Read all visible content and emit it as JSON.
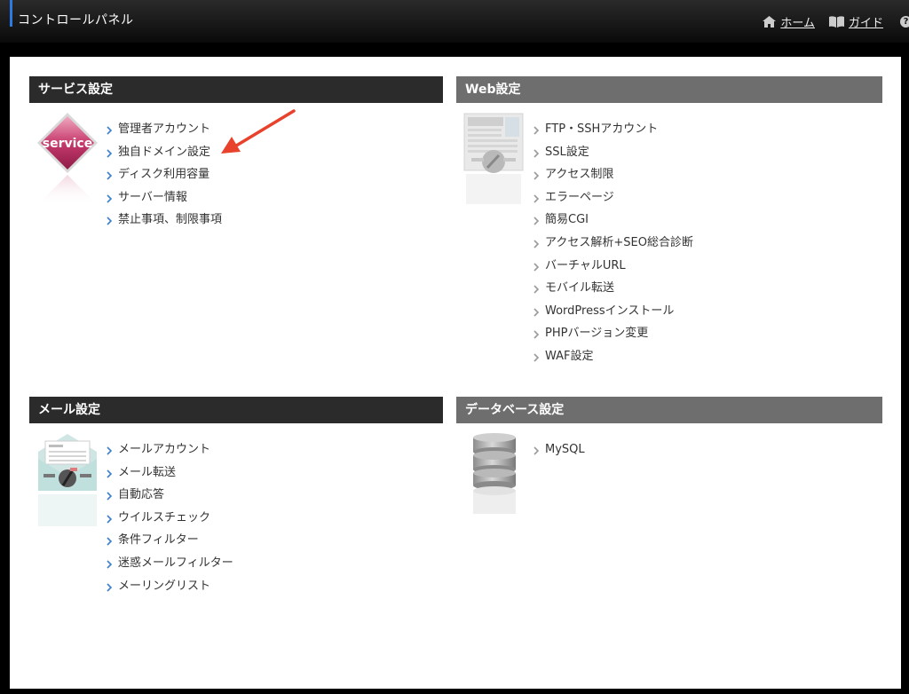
{
  "header": {
    "title": "コントロールパネル",
    "nav": [
      {
        "label": "ホーム",
        "icon": "home-icon"
      },
      {
        "label": "ガイド",
        "icon": "book-icon"
      }
    ],
    "help_icon": "?"
  },
  "sections": {
    "service": {
      "title": "サービス設定",
      "icon": "service-icon",
      "icon_text": "service",
      "items": [
        "管理者アカウント",
        "独自ドメイン設定",
        "ディスク利用容量",
        "サーバー情報",
        "禁止事項、制限事項"
      ]
    },
    "web": {
      "title": "Web設定",
      "icon": "web-icon",
      "items": [
        "FTP・SSHアカウント",
        "SSL設定",
        "アクセス制限",
        "エラーページ",
        "簡易CGI",
        "アクセス解析+SEO総合診断",
        "バーチャルURL",
        "モバイル転送",
        "WordPressインストール",
        "PHPバージョン変更",
        "WAF設定"
      ]
    },
    "mail": {
      "title": "メール設定",
      "icon": "mail-icon",
      "items": [
        "メールアカウント",
        "メール転送",
        "自動応答",
        "ウイルスチェック",
        "条件フィルター",
        "迷惑メールフィルター",
        "メーリングリスト"
      ]
    },
    "database": {
      "title": "データベース設定",
      "icon": "database-icon",
      "items": [
        "MySQL"
      ]
    }
  },
  "colors": {
    "accent": "#2e7be0",
    "link_chevron_blue": "#3a7fd0",
    "link_chevron_gray": "#9a9a9a",
    "annotation_arrow": "#e8412c"
  }
}
